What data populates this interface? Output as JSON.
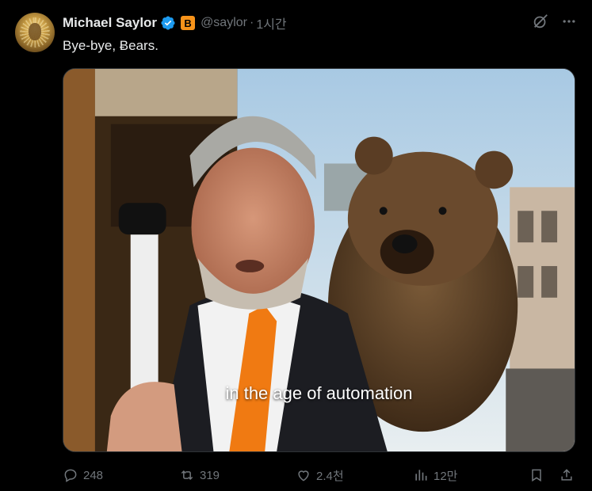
{
  "post": {
    "author_name": "Michael Saylor",
    "badge_symbol": "B",
    "handle": "@saylor",
    "separator": "·",
    "time": "1시간",
    "text": "Bye-bye, Ƀears.",
    "caption": "in the age of automation"
  },
  "stats": {
    "replies": "248",
    "reposts": "319",
    "likes": "2.4천",
    "views": "12만"
  },
  "icons": {
    "verified": "verified-badge-icon",
    "grok": "grok-icon",
    "more": "more-icon",
    "reply": "reply-icon",
    "repost": "repost-icon",
    "like": "heart-icon",
    "views": "views-icon",
    "bookmark": "bookmark-icon",
    "share": "share-icon"
  },
  "colors": {
    "background": "#000000",
    "text": "#e7e9ea",
    "muted": "#71767b",
    "verified": "#1d9bf0",
    "bitcoin": "#f7931a",
    "tie": "#f07a12"
  }
}
